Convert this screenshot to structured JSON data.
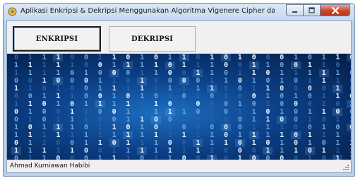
{
  "window": {
    "title": "Aplikasi Enkripsi & Dekripsi Menggunakan Algoritma Vigenere Cipher dan One Ti..."
  },
  "icons": {
    "app": "app-icon",
    "minimize": "minimize-icon",
    "maximize": "maximize-icon",
    "close": "close-icon"
  },
  "toolbar": {
    "enkripsi_label": "ENKRIPSI",
    "dekripsi_label": "DEKRIPSI"
  },
  "banner": {
    "rows": [
      "0111001101011010100010110",
      "1111100111101110011001101",
      "1111010001100110110111110",
      "0010001101000011010101110",
      "1101001111111110011000010",
      "0011100101000101001010110",
      "1101011111100000101000101",
      "0100110011111010110101100",
      "0101110011001010011001011",
      "1011101101000000011100100",
      "1111111111111110111101111",
      "0110011011100111010101011",
      "1111100111111110001110111",
      "0110001110110010100001011"
    ],
    "colors": {
      "bright": "#e9f3ff",
      "mid": "#6fa6de",
      "dim": "#2a63a8"
    }
  },
  "status": {
    "author": "Ahmad Kurniawan Habibi"
  },
  "colors": {
    "title_bar": "#c6d9ee",
    "close_button": "#c7462c",
    "window_bg": "#f0f0f0",
    "banner_blue": "#0b3f86"
  }
}
